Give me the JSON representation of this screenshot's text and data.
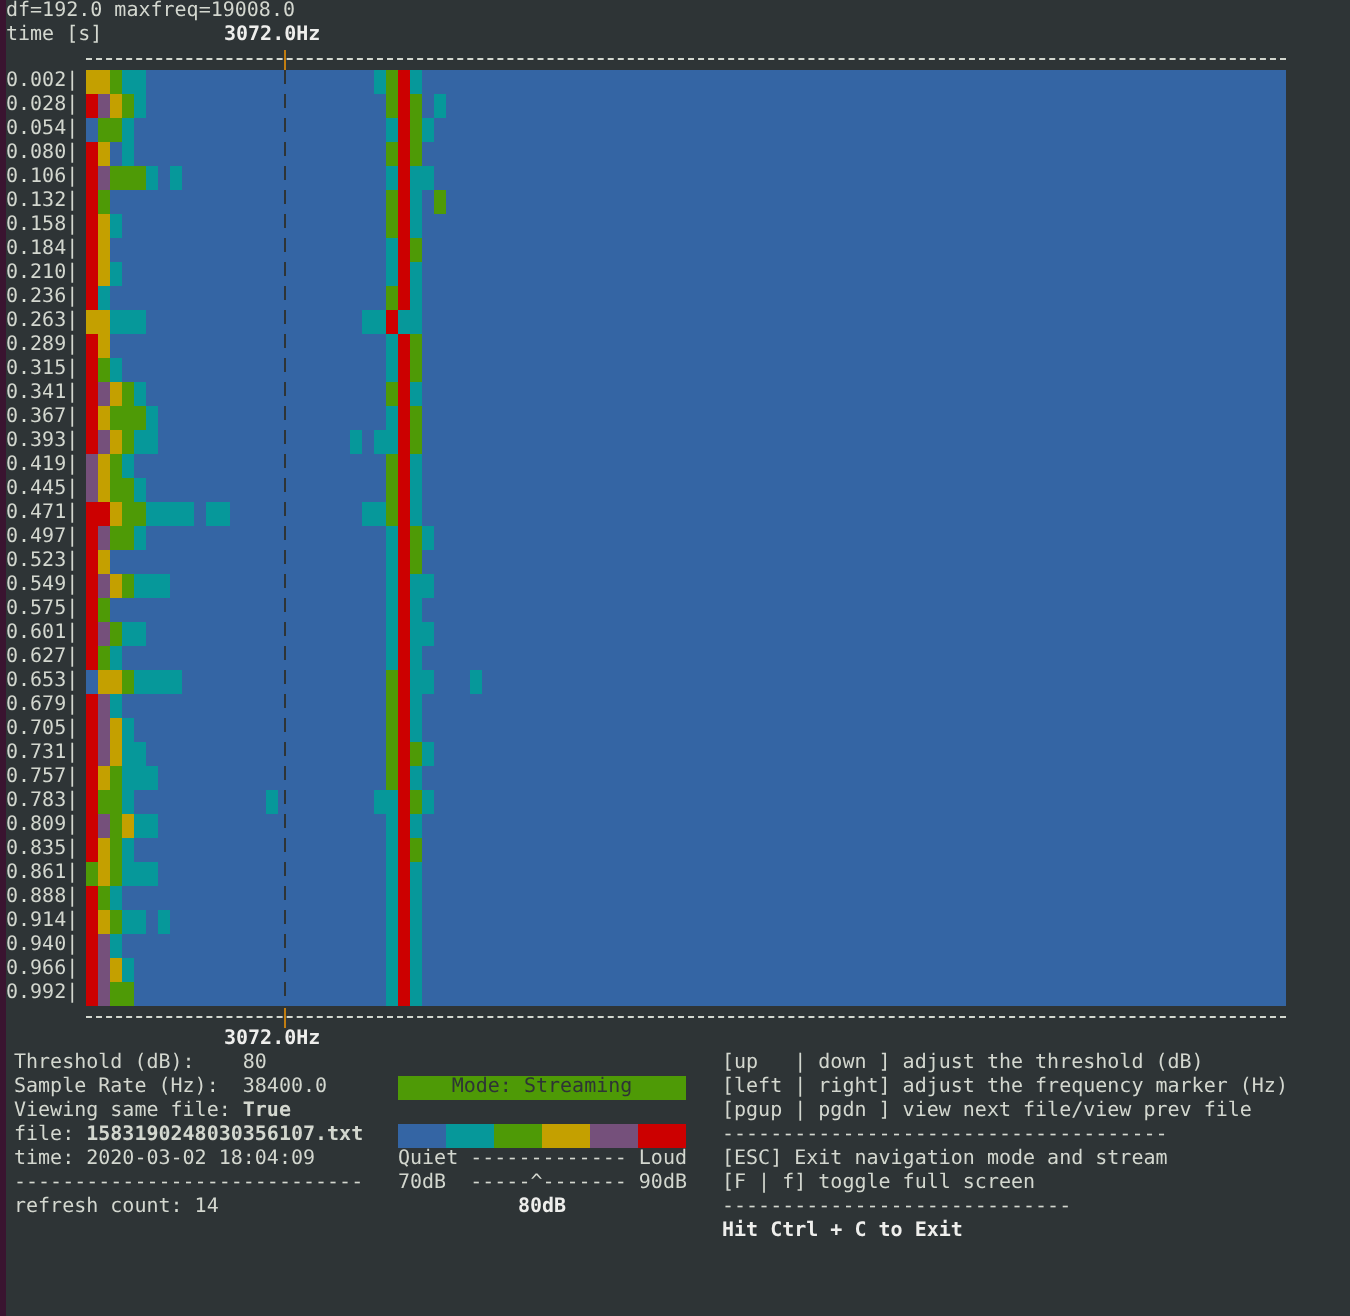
{
  "header": {
    "info": "df=192.0 maxfreq=19008.0",
    "axis_label": "time [s]",
    "marker_label": "3072.0Hz"
  },
  "spectrogram": {
    "rows": [
      {
        "time": "0.002|"
      },
      {
        "time": "0.028|"
      },
      {
        "time": "0.054|"
      },
      {
        "time": "0.080|"
      },
      {
        "time": "0.106|"
      },
      {
        "time": "0.132|"
      },
      {
        "time": "0.158|"
      },
      {
        "time": "0.184|"
      },
      {
        "time": "0.210|"
      },
      {
        "time": "0.236|"
      },
      {
        "time": "0.263|"
      },
      {
        "time": "0.289|"
      },
      {
        "time": "0.315|"
      },
      {
        "time": "0.341|"
      },
      {
        "time": "0.367|"
      },
      {
        "time": "0.393|"
      },
      {
        "time": "0.419|"
      },
      {
        "time": "0.445|"
      },
      {
        "time": "0.471|"
      },
      {
        "time": "0.497|"
      },
      {
        "time": "0.523|"
      },
      {
        "time": "0.549|"
      },
      {
        "time": "0.575|"
      },
      {
        "time": "0.601|"
      },
      {
        "time": "0.627|"
      },
      {
        "time": "0.653|"
      },
      {
        "time": "0.679|"
      },
      {
        "time": "0.705|"
      },
      {
        "time": "0.731|"
      },
      {
        "time": "0.757|"
      },
      {
        "time": "0.783|"
      },
      {
        "time": "0.809|"
      },
      {
        "time": "0.835|"
      },
      {
        "time": "0.861|"
      },
      {
        "time": "0.888|"
      },
      {
        "time": "0.914|"
      },
      {
        "time": "0.940|"
      },
      {
        "time": "0.966|"
      },
      {
        "time": "0.992|"
      }
    ],
    "marker_label": "3072.0Hz"
  },
  "status": [
    "Threshold (dB):    80",
    "Sample Rate (Hz):  38400.0",
    "Viewing same file: **True**",
    "file: **1583190248030356107.txt**",
    "time: 2020-03-02 18:04:09",
    "-----------------------------",
    "refresh count: 14"
  ],
  "mode": {
    "label": "Mode: Streaming"
  },
  "legend": {
    "colors": [
      {
        "color": "#3465a4"
      },
      {
        "color": "#06989a"
      },
      {
        "color": "#4e9a06"
      },
      {
        "color": "#c4a000"
      },
      {
        "color": "#75507b"
      },
      {
        "color": "#cc0000"
      }
    ],
    "scale_line": "Quiet ------------- Loud",
    "range_line": "70dB  -----^------- 90dB",
    "threshold": "80dB"
  },
  "help": [
    {
      "kind": "text",
      "text": "[up   | down ] adjust the threshold (dB)"
    },
    {
      "kind": "text",
      "text": "[left | right] adjust the frequency marker (Hz)"
    },
    {
      "kind": "text",
      "text": "[pgup | pgdn ] view next file/view prev file"
    },
    {
      "kind": "text",
      "text": "-------------------------------------"
    },
    {
      "kind": "text",
      "text": "[ESC] Exit navigation mode and stream"
    },
    {
      "kind": "text",
      "text": "[F | f] toggle full screen"
    },
    {
      "kind": "text",
      "text": "-----------------------------"
    },
    {
      "kind": "exit",
      "text": "Hit Ctrl + C to Exit"
    }
  ]
}
